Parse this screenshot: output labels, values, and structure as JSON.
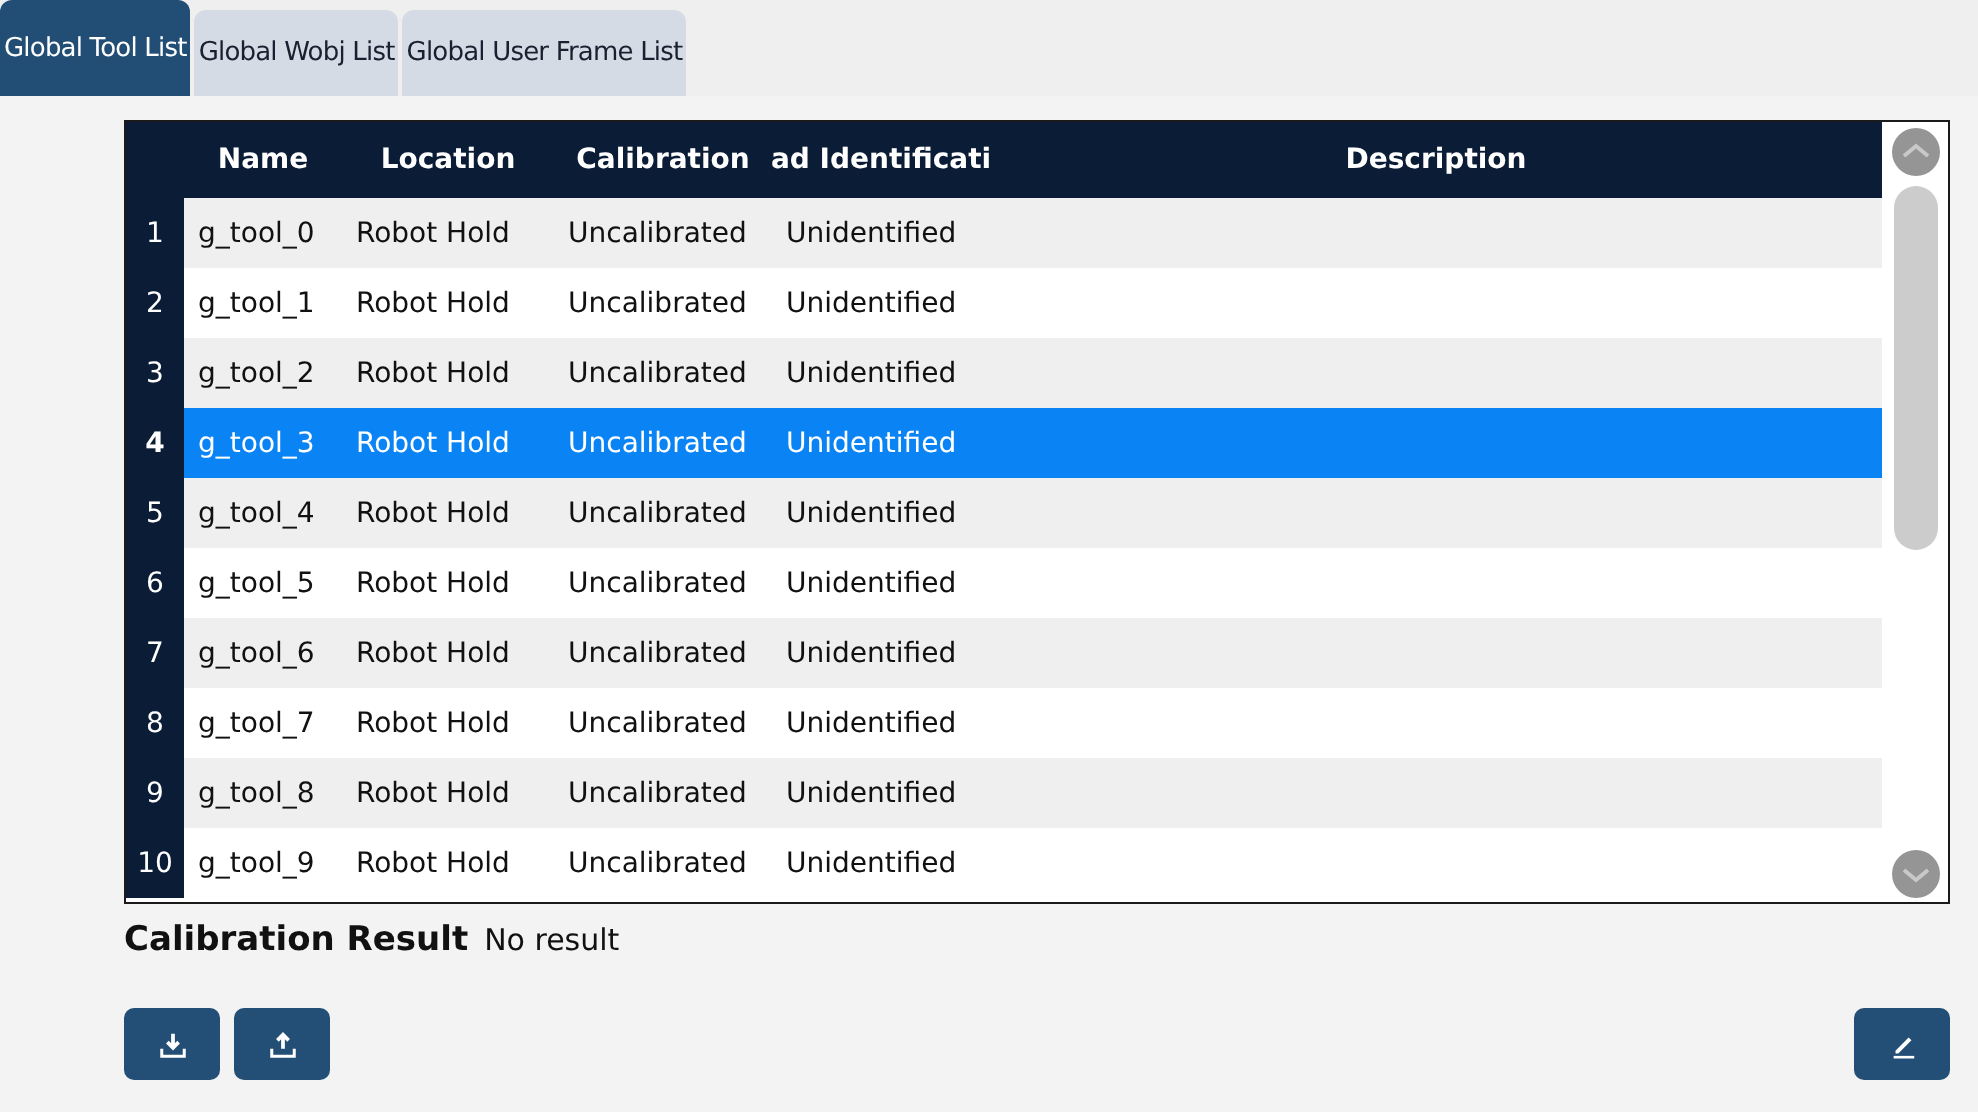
{
  "tabs": [
    {
      "label": "Global Tool List",
      "selected": true
    },
    {
      "label": "Global Wobj List",
      "selected": false
    },
    {
      "label": "Global User Frame List",
      "selected": false
    }
  ],
  "table": {
    "columns": [
      "Name",
      "Location",
      "Calibration",
      "ad Identificati",
      "Description"
    ],
    "rows": [
      {
        "index": "1",
        "cells": [
          "g_tool_0",
          "Robot Hold",
          "Uncalibrated",
          "Unidentified"
        ],
        "selected": false
      },
      {
        "index": "2",
        "cells": [
          "g_tool_1",
          "Robot Hold",
          "Uncalibrated",
          "Unidentified"
        ],
        "selected": false
      },
      {
        "index": "3",
        "cells": [
          "g_tool_2",
          "Robot Hold",
          "Uncalibrated",
          "Unidentified"
        ],
        "selected": false
      },
      {
        "index": "4",
        "cells": [
          "g_tool_3",
          "Robot Hold",
          "Uncalibrated",
          "Unidentified"
        ],
        "selected": true
      },
      {
        "index": "5",
        "cells": [
          "g_tool_4",
          "Robot Hold",
          "Uncalibrated",
          "Unidentified"
        ],
        "selected": false
      },
      {
        "index": "6",
        "cells": [
          "g_tool_5",
          "Robot Hold",
          "Uncalibrated",
          "Unidentified"
        ],
        "selected": false
      },
      {
        "index": "7",
        "cells": [
          "g_tool_6",
          "Robot Hold",
          "Uncalibrated",
          "Unidentified"
        ],
        "selected": false
      },
      {
        "index": "8",
        "cells": [
          "g_tool_7",
          "Robot Hold",
          "Uncalibrated",
          "Unidentified"
        ],
        "selected": false
      },
      {
        "index": "9",
        "cells": [
          "g_tool_8",
          "Robot Hold",
          "Uncalibrated",
          "Unidentified"
        ],
        "selected": false
      },
      {
        "index": "10",
        "cells": [
          "g_tool_9",
          "Robot Hold",
          "Uncalibrated",
          "Unidentified"
        ],
        "selected": false
      }
    ]
  },
  "calibration_result": {
    "label": "Calibration Result",
    "value": "No result"
  }
}
